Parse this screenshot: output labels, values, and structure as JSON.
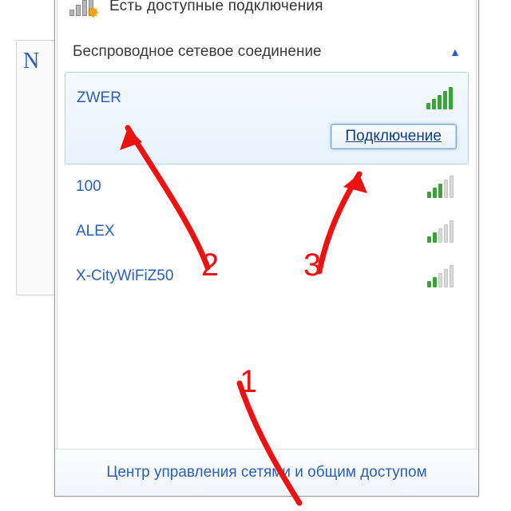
{
  "cropLetter": "N",
  "topStatus": "Есть доступные подключения",
  "sectionTitle": "Беспроводное сетевое соединение",
  "connectLabel": "Подключение",
  "networks": [
    {
      "name": "ZWER",
      "signal": 5,
      "selected": true
    },
    {
      "name": "100",
      "signal": 3,
      "selected": false
    },
    {
      "name": "ALEX",
      "signal": 2,
      "selected": false
    },
    {
      "name": "X-CityWiFiZ50",
      "signal": 2,
      "selected": false
    }
  ],
  "footer": "Центр управления сетями и общим доступом",
  "annotations": {
    "n1": "1",
    "n2": "2",
    "n3": "3"
  }
}
